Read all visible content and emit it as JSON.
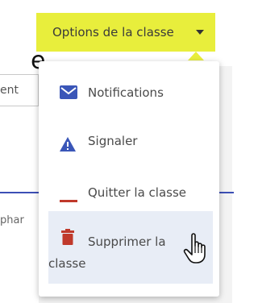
{
  "background": {
    "peek_heading_fragment": "e",
    "peek_input_fragment": "ent",
    "peek_text_fragment": "phar"
  },
  "options_button": {
    "label": "Options de la classe",
    "accent_color": "#e8ee3c"
  },
  "menu": {
    "items": [
      {
        "label": "Notifications",
        "icon": "envelope-icon",
        "icon_color": "#3a56b8"
      },
      {
        "label": "Signaler",
        "icon": "warning-triangle-icon",
        "icon_color": "#3a56b8"
      },
      {
        "label": "Quitter la classe",
        "icon": "minus-icon",
        "icon_color": "#c0392b"
      },
      {
        "label_line1": "Supprimer la",
        "label_line2": "classe",
        "icon": "trash-icon",
        "icon_color": "#c0392b",
        "highlighted": true
      }
    ]
  },
  "cursor": "hand-pointer-icon"
}
